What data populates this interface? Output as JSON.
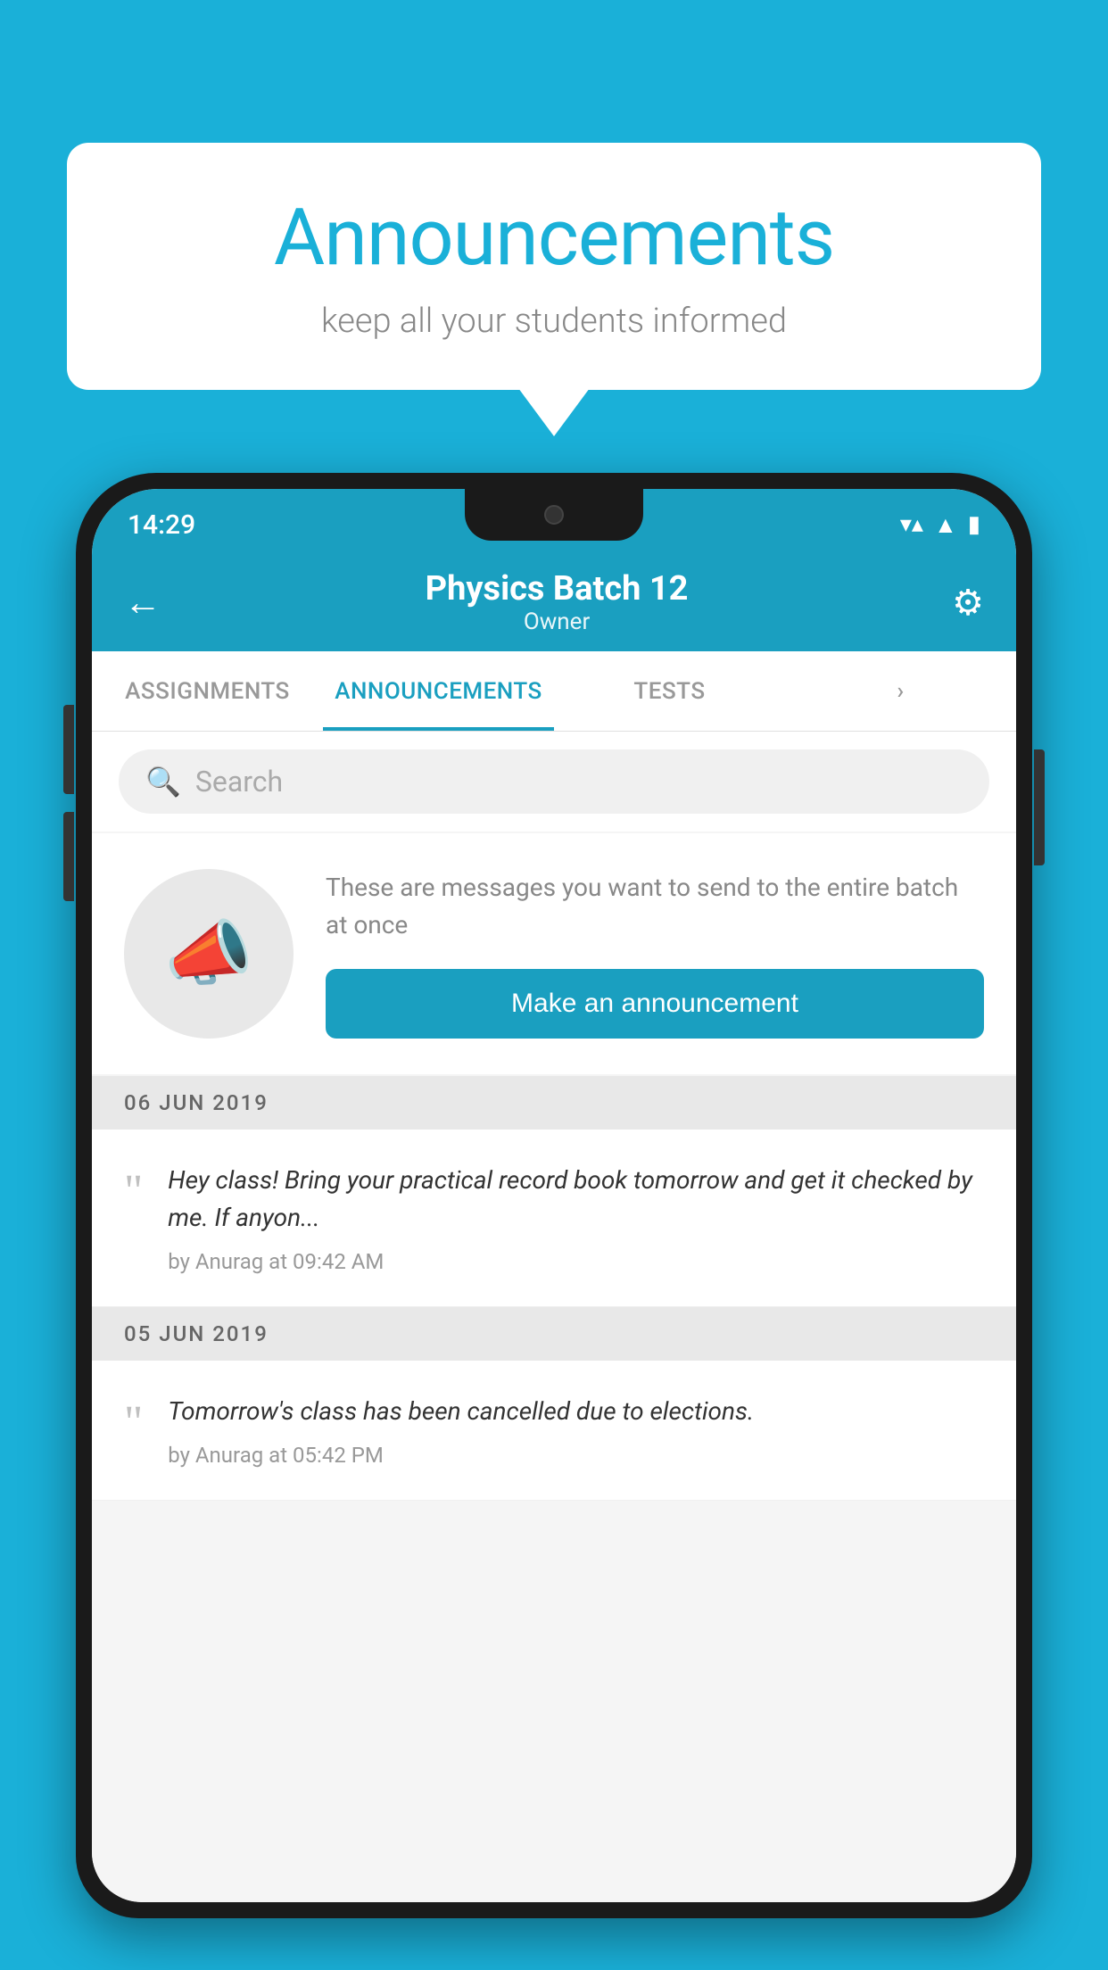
{
  "bubble": {
    "title": "Announcements",
    "subtitle": "keep all your students informed"
  },
  "status_bar": {
    "time": "14:29",
    "icons": [
      "wifi",
      "signal",
      "battery"
    ]
  },
  "app_bar": {
    "title": "Physics Batch 12",
    "subtitle": "Owner",
    "back_label": "←",
    "settings_label": "⚙"
  },
  "tabs": [
    {
      "label": "ASSIGNMENTS",
      "active": false
    },
    {
      "label": "ANNOUNCEMENTS",
      "active": true
    },
    {
      "label": "TESTS",
      "active": false
    },
    {
      "label": "›",
      "active": false
    }
  ],
  "search": {
    "placeholder": "Search"
  },
  "intro": {
    "description": "These are messages you want to send to the entire batch at once",
    "button_label": "Make an announcement"
  },
  "announcements": [
    {
      "date": "06  JUN  2019",
      "message": "Hey class! Bring your practical record book tomorrow and get it checked by me. If anyon...",
      "meta": "by Anurag at 09:42 AM"
    },
    {
      "date": "05  JUN  2019",
      "message": "Tomorrow's class has been cancelled due to elections.",
      "meta": "by Anurag at 05:42 PM"
    }
  ],
  "colors": {
    "brand": "#1a9fc0",
    "background": "#1ab0d8"
  }
}
